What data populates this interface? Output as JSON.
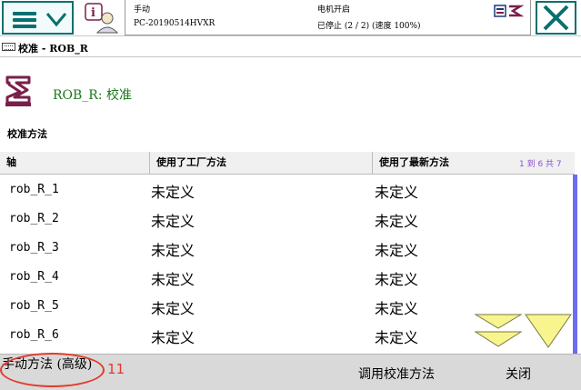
{
  "status": {
    "mode": "手动",
    "controller": "PC-20190514HVXR",
    "motor": "电机开启",
    "state": "已停止 (2 / 2) (速度 100%)"
  },
  "window": {
    "title": "校准 - ROB_R"
  },
  "header": {
    "unit_title": "ROB_R:  校准"
  },
  "section": {
    "label": "校准方法"
  },
  "table": {
    "columns": [
      "轴",
      "使用了工厂方法",
      "使用了最新方法"
    ],
    "pager": "1 到 6 共 7",
    "rows": [
      {
        "axis": "rob_R_1",
        "factory": "未定义",
        "latest": "未定义"
      },
      {
        "axis": "rob_R_2",
        "factory": "未定义",
        "latest": "未定义"
      },
      {
        "axis": "rob_R_3",
        "factory": "未定义",
        "latest": "未定义"
      },
      {
        "axis": "rob_R_4",
        "factory": "未定义",
        "latest": "未定义"
      },
      {
        "axis": "rob_R_5",
        "factory": "未定义",
        "latest": "未定义"
      },
      {
        "axis": "rob_R_6",
        "factory": "未定义",
        "latest": "未定义"
      }
    ]
  },
  "commands": {
    "manual": "手动方法 (高级)",
    "call": "调用校准方法",
    "close": "关闭"
  },
  "annotation": {
    "number": "11"
  },
  "icons": {
    "menu": "hamburger-menu-icon",
    "info": "info-person-icon",
    "close": "close-icon",
    "robot": "robot-arm-icon",
    "scroll_down": "scroll-down-icon",
    "page_down": "page-down-icon"
  },
  "colors": {
    "accent": "#0a6f6f",
    "title_green": "#1a7a1a",
    "robot": "#7a1f4a",
    "annotation": "#e23a2a",
    "pager": "#8a4fd0"
  }
}
